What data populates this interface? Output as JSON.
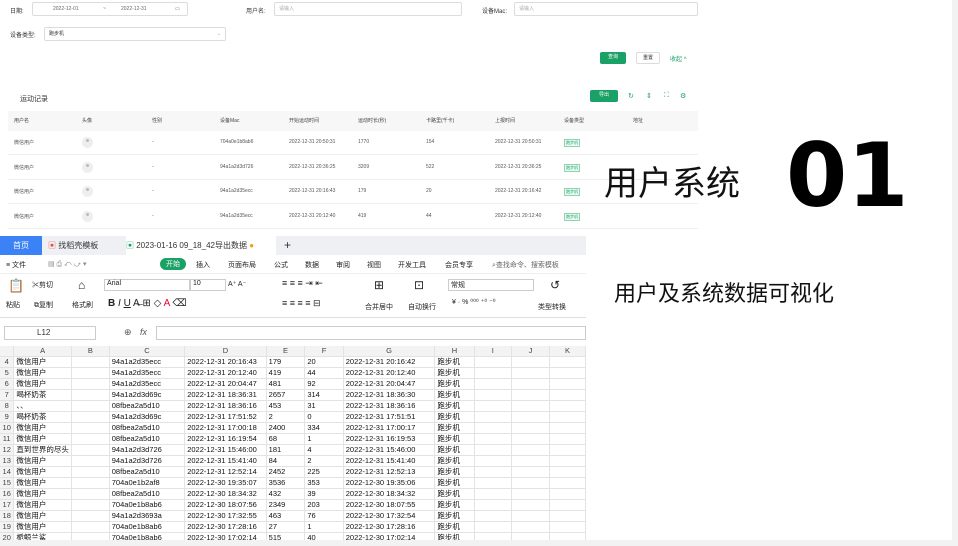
{
  "filters": {
    "date_label": "日期:",
    "date_start": "2022-12-01",
    "date_sep": "~",
    "date_end": "2022-12-31",
    "user_label": "用户名:",
    "user_placeholder": "请输入",
    "mac_label": "设备Mac:",
    "mac_placeholder": "请输入",
    "type_label": "设备类型:",
    "type_value": "跑步机",
    "query": "查询",
    "reset": "重置",
    "collapse": "收起"
  },
  "records": {
    "title": "运动记录",
    "export": "导出",
    "columns": [
      "用户名",
      "头像",
      "性别",
      "设备Mac",
      "开始运动时间",
      "运动时长(秒)",
      "卡路里(千卡)",
      "上报时间",
      "设备类型",
      "地址"
    ],
    "rows": [
      [
        "微信用户",
        "",
        "-",
        "704a0e1b8ab6",
        "2022-12-31 20:50:31",
        "1770",
        "154",
        "2022-12-31 20:50:31",
        "跑步机"
      ],
      [
        "微信用户",
        "",
        "-",
        "94a1a2d3d726",
        "2022-12-31 20:36:25",
        "3209",
        "522",
        "2022-12-31 20:36:25",
        "跑步机"
      ],
      [
        "微信用户",
        "",
        "-",
        "94a1a2d35ecc",
        "2022-12-31 20:16:43",
        "179",
        "20",
        "2022-12-31 20:16:42",
        "跑步机"
      ],
      [
        "微信用户",
        "",
        "-",
        "94a1a2d35ecc",
        "2022-12-31 20:12:40",
        "419",
        "44",
        "2022-12-31 20:12:40",
        "跑步机"
      ]
    ]
  },
  "headline": {
    "title": "用户系统",
    "number": "01",
    "subtitle": "用户及系统数据可视化"
  },
  "spreadsheet": {
    "tabs": [
      "首页",
      "找稻壳模板",
      "2023-01-16 09_18_42导出数据"
    ],
    "menu": [
      "≡ 文件",
      "开始",
      "插入",
      "页面布局",
      "公式",
      "数据",
      "审阅",
      "视图",
      "开发工具",
      "会员专享",
      "查找命令、搜索模板"
    ],
    "ribbon": {
      "paste": "粘贴",
      "cut": "剪切",
      "copy": "复制",
      "format_painter": "格式刷",
      "font": "Arial",
      "size": "10",
      "merge": "合并居中",
      "wrap": "自动换行",
      "number_format": "常规",
      "type_convert": "类型转换"
    },
    "cell_ref": "L12",
    "fx": "fx",
    "col_headers": [
      "A",
      "B",
      "C",
      "D",
      "E",
      "F",
      "G",
      "H",
      "I",
      "J",
      "K"
    ],
    "rows": [
      [
        "4",
        "微信用户",
        "",
        "94a1a2d35ecc",
        "2022-12-31 20:16:43",
        "179",
        "20",
        "2022-12-31 20:16:42",
        "跑步机"
      ],
      [
        "5",
        "微信用户",
        "",
        "94a1a2d35ecc",
        "2022-12-31 20:12:40",
        "419",
        "44",
        "2022-12-31 20:12:40",
        "跑步机"
      ],
      [
        "6",
        "微信用户",
        "",
        "94a1a2d35ecc",
        "2022-12-31 20:04:47",
        "481",
        "92",
        "2022-12-31 20:04:47",
        "跑步机"
      ],
      [
        "7",
        "喝杯奶茶",
        "",
        "94a1a2d3d69c",
        "2022-12-31 18:36:31",
        "2657",
        "314",
        "2022-12-31 18:36:30",
        "跑步机"
      ],
      [
        "8",
        "、、",
        "",
        "08fbea2a5d10",
        "2022-12-31 18:36:16",
        "453",
        "31",
        "2022-12-31 18:36:16",
        "跑步机"
      ],
      [
        "9",
        "喝杯奶茶",
        "",
        "94a1a2d3d69c",
        "2022-12-31 17:51:52",
        "2",
        "0",
        "2022-12-31 17:51:51",
        "跑步机"
      ],
      [
        "10",
        "微信用户",
        "",
        "08fbea2a5d10",
        "2022-12-31 17:00:18",
        "2400",
        "334",
        "2022-12-31 17:00:17",
        "跑步机"
      ],
      [
        "11",
        "微信用户",
        "",
        "08fbea2a5d10",
        "2022-12-31 16:19:54",
        "68",
        "1",
        "2022-12-31 16:19:53",
        "跑步机"
      ],
      [
        "12",
        "直到世界的尽头",
        "",
        "94a1a2d3d726",
        "2022-12-31 15:46:00",
        "181",
        "4",
        "2022-12-31 15:46:00",
        "跑步机"
      ],
      [
        "13",
        "微信用户",
        "",
        "94a1a2d3d726",
        "2022-12-31 15:41:40",
        "84",
        "2",
        "2022-12-31 15:41:40",
        "跑步机"
      ],
      [
        "14",
        "微信用户",
        "",
        "08fbea2a5d10",
        "2022-12-31 12:52:14",
        "2452",
        "225",
        "2022-12-31 12:52:13",
        "跑步机"
      ],
      [
        "15",
        "微信用户",
        "",
        "704a0e1b2af8",
        "2022-12-30 19:35:07",
        "3536",
        "353",
        "2022-12-30 19:35:06",
        "跑步机"
      ],
      [
        "16",
        "微信用户",
        "",
        "08fbea2a5d10",
        "2022-12-30 18:34:32",
        "432",
        "39",
        "2022-12-30 18:34:32",
        "跑步机"
      ],
      [
        "17",
        "微信用户",
        "",
        "704a0e1b8ab6",
        "2022-12-30 18:07:56",
        "2349",
        "203",
        "2022-12-30 18:07:55",
        "跑步机"
      ],
      [
        "18",
        "微信用户",
        "",
        "94a1a2d3693a",
        "2022-12-30 17:32:55",
        "463",
        "76",
        "2022-12-30 17:32:54",
        "跑步机"
      ],
      [
        "19",
        "微信用户",
        "",
        "704a0e1b8ab6",
        "2022-12-30 17:28:16",
        "27",
        "1",
        "2022-12-30 17:28:16",
        "跑步机"
      ],
      [
        "20",
        "栀鲸兰鲨",
        "",
        "704a0e1b8ab6",
        "2022-12-30 17:02:14",
        "515",
        "40",
        "2022-12-30 17:02:14",
        "跑步机"
      ]
    ]
  },
  "colors": {
    "accent": "#1aa166",
    "tab_active": "#3b82f6"
  }
}
